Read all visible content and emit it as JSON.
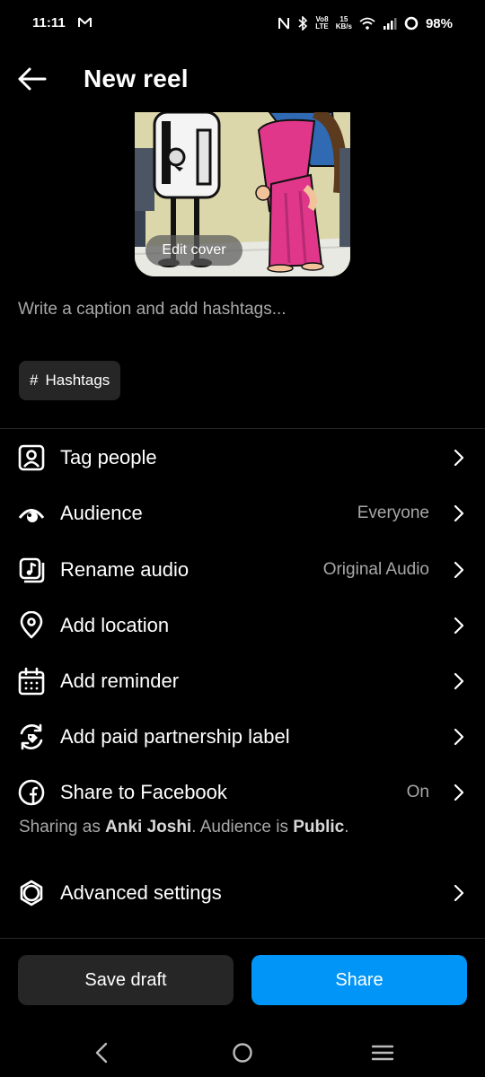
{
  "status": {
    "time": "11:11",
    "volte_top": "Vo8",
    "volte_bottom": "LTE",
    "speed_top": "15",
    "speed_bottom": "KB/s",
    "battery": "98%"
  },
  "header": {
    "title": "New reel"
  },
  "cover": {
    "edit_label": "Edit cover"
  },
  "caption": {
    "placeholder": "Write a caption and add hashtags..."
  },
  "hashtags": {
    "glyph": "#",
    "label": "Hashtags"
  },
  "options": {
    "tag_people": {
      "label": "Tag people",
      "icon": "tag-person-icon"
    },
    "audience": {
      "label": "Audience",
      "value": "Everyone",
      "icon": "eye-icon"
    },
    "rename_audio": {
      "label": "Rename audio",
      "value": "Original Audio",
      "icon": "music-note-icon"
    },
    "add_location": {
      "label": "Add location",
      "icon": "location-pin-icon"
    },
    "add_reminder": {
      "label": "Add reminder",
      "icon": "calendar-icon"
    },
    "paid_partnership": {
      "label": "Add paid partnership label",
      "icon": "partnership-icon"
    },
    "share_facebook": {
      "label": "Share to Facebook",
      "value": "On",
      "icon": "facebook-icon"
    },
    "advanced": {
      "label": "Advanced settings",
      "icon": "gear-icon"
    }
  },
  "share_note": {
    "prefix": "Sharing as ",
    "name": "Anki Joshi",
    "middle": ". Audience is ",
    "audience": "Public",
    "suffix": "."
  },
  "actions": {
    "save_draft": "Save draft",
    "share": "Share"
  },
  "colors": {
    "background": "#000000",
    "surface": "#262626",
    "accent": "#0095f6",
    "secondary_text": "#a8a8a8"
  }
}
